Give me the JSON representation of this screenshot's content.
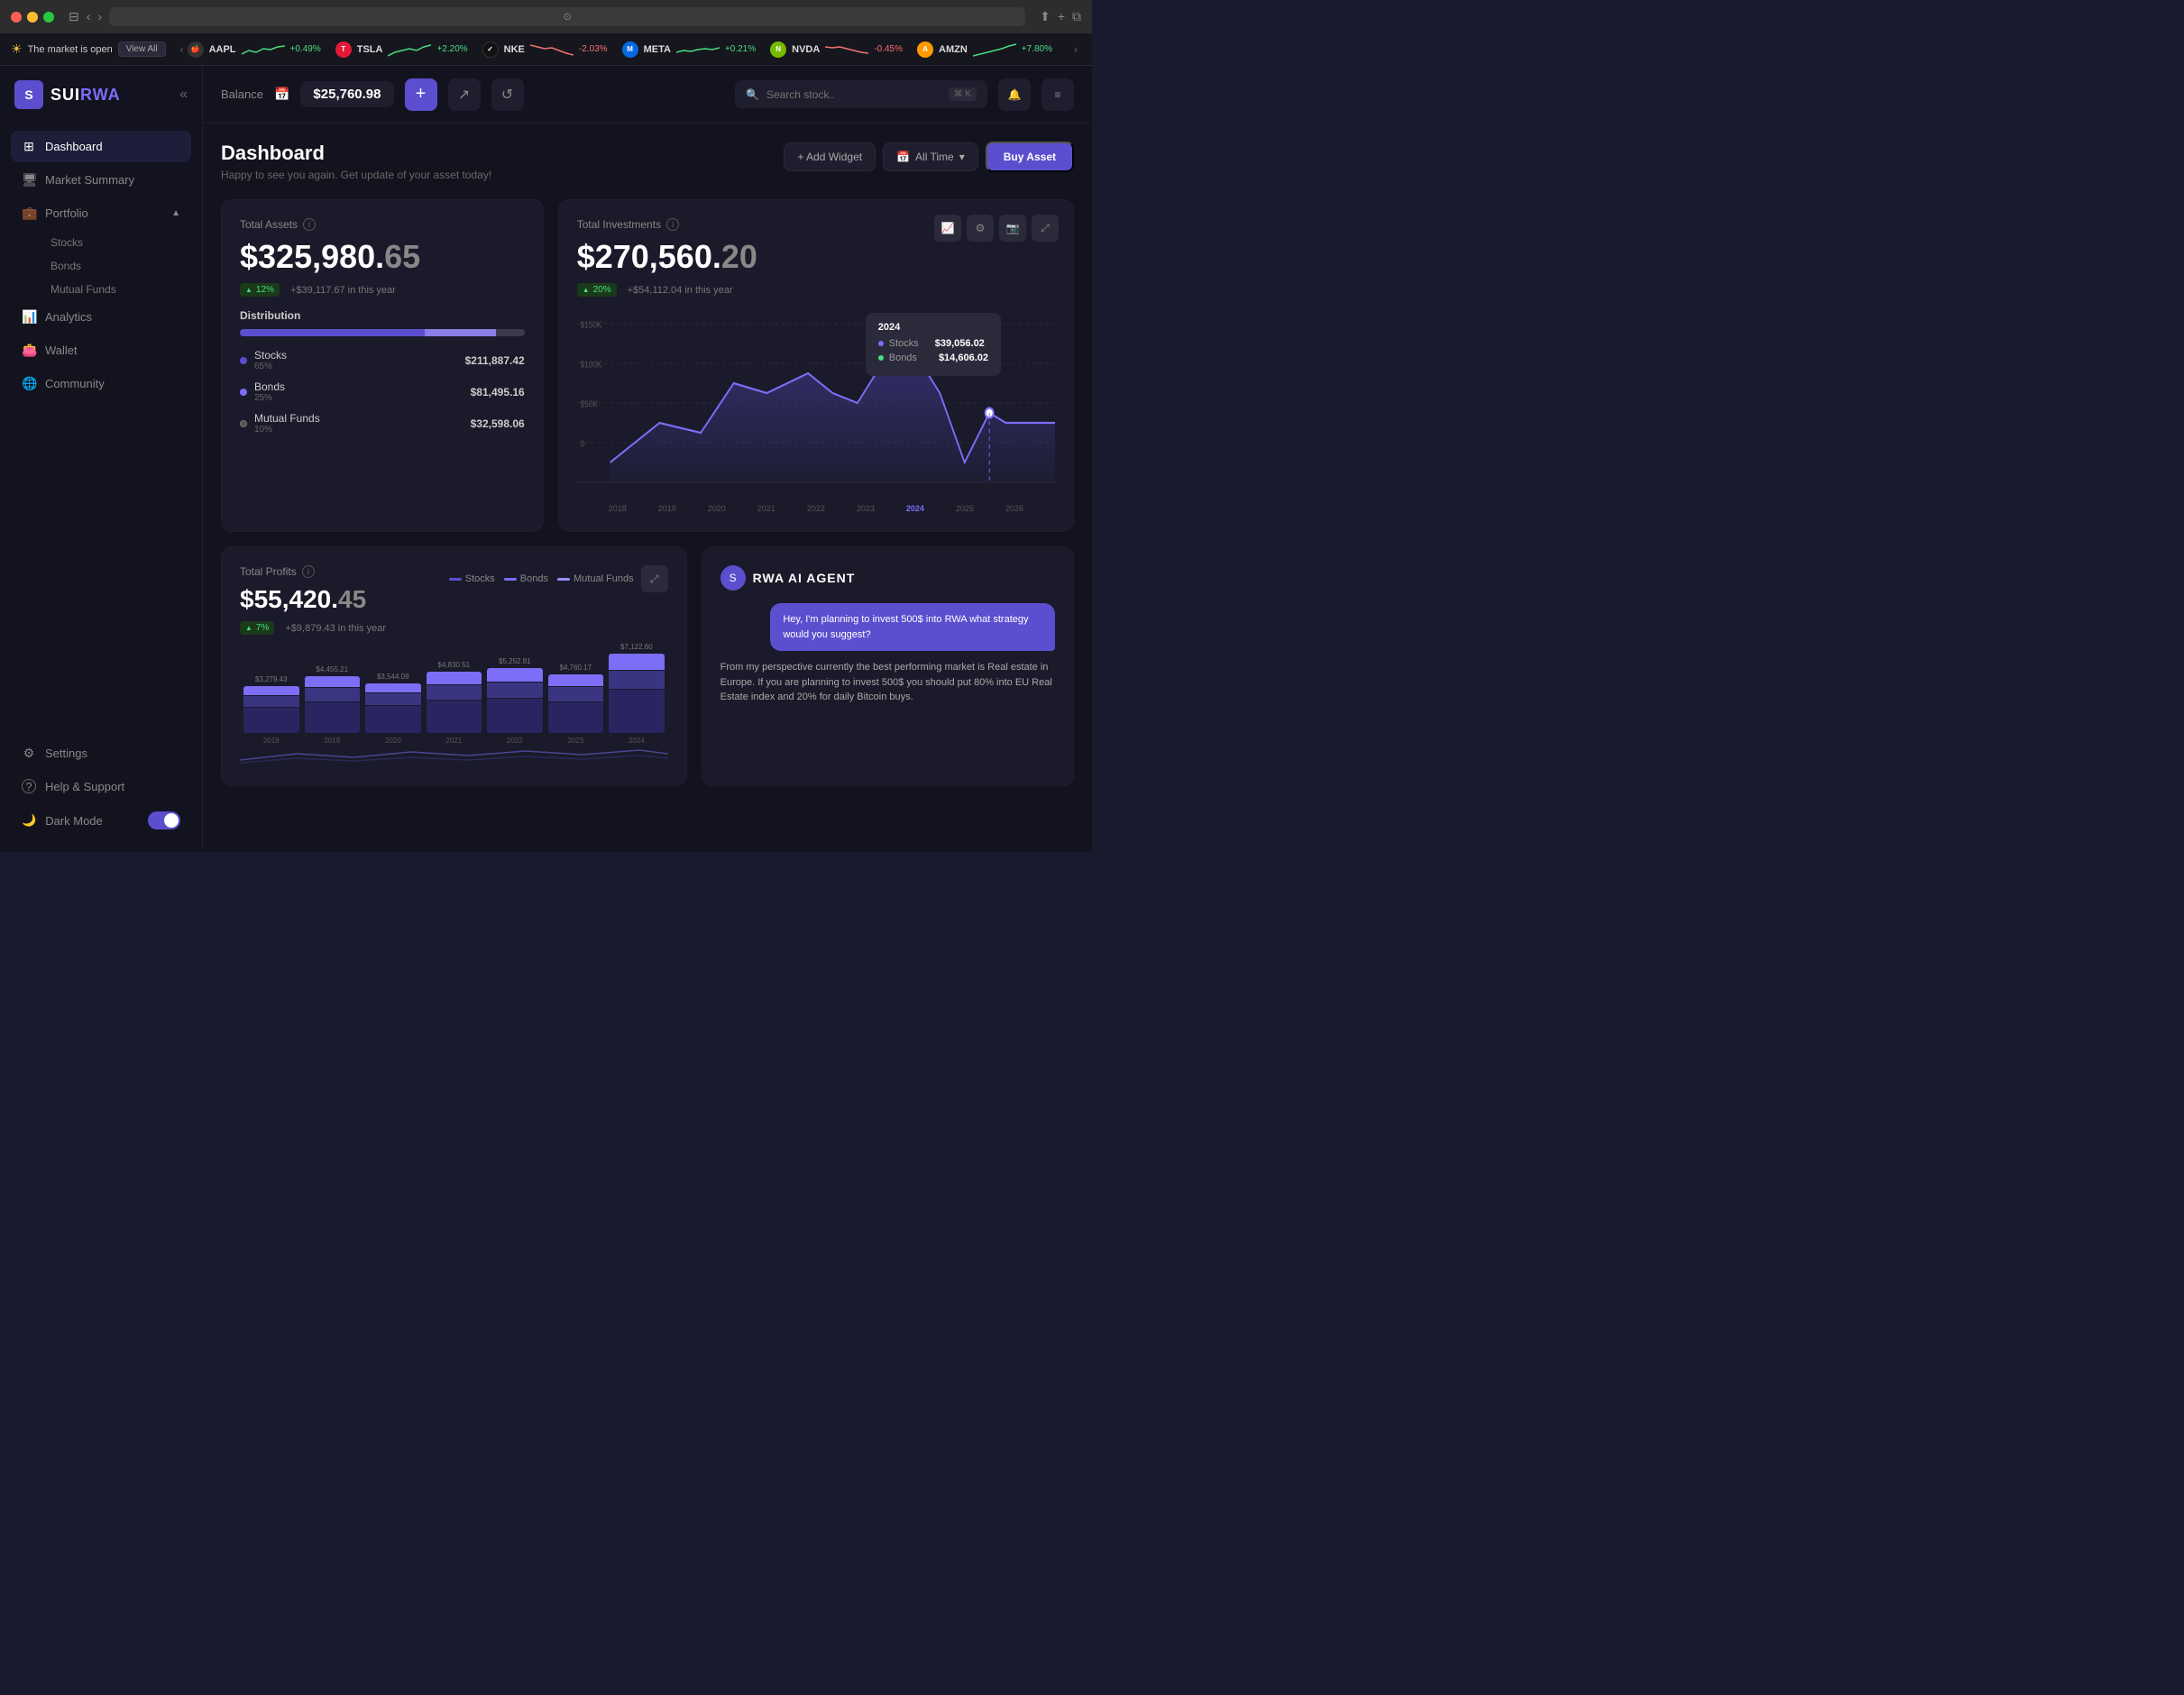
{
  "browser": {
    "address": ""
  },
  "ticker": {
    "market_status": "The market is open",
    "view_all": "View All",
    "items": [
      {
        "symbol": "AAPL",
        "logo_text": "🍎",
        "logo_bg": "#333",
        "change": "+0.49%",
        "positive": true
      },
      {
        "symbol": "TSLA",
        "logo_text": "T",
        "logo_bg": "#e31937",
        "change": "+2.20%",
        "positive": true
      },
      {
        "symbol": "NKE",
        "logo_text": "✓",
        "logo_bg": "#111",
        "change": "-2.03%",
        "positive": false
      },
      {
        "symbol": "META",
        "logo_text": "M",
        "logo_bg": "#0668E1",
        "change": "+0.21%",
        "positive": true
      },
      {
        "symbol": "NVDA",
        "logo_text": "N",
        "logo_bg": "#76b900",
        "change": "-0.45%",
        "positive": false
      },
      {
        "symbol": "AMZN",
        "logo_text": "A",
        "logo_bg": "#FF9900",
        "change": "+7.80%",
        "positive": true
      }
    ]
  },
  "topbar": {
    "balance_label": "Balance",
    "balance_value": "$25,760.98",
    "search_placeholder": "Search stock..",
    "search_kbd": "⌘ K"
  },
  "sidebar": {
    "logo_s": "S",
    "logo_name_sui": "SUI",
    "logo_name_rwa": "RWA",
    "items": [
      {
        "id": "dashboard",
        "label": "Dashboard",
        "icon": "⊞",
        "active": true
      },
      {
        "id": "market-summary",
        "label": "Market Summary",
        "icon": "🖥"
      },
      {
        "id": "portfolio",
        "label": "Portfolio",
        "icon": "💼",
        "has_sub": true
      },
      {
        "id": "stocks",
        "label": "Stocks",
        "sub": true
      },
      {
        "id": "bonds",
        "label": "Bonds",
        "sub": true
      },
      {
        "id": "mutual-funds",
        "label": "Mutual Funds",
        "sub": true
      },
      {
        "id": "analytics",
        "label": "Analytics",
        "icon": "📊"
      },
      {
        "id": "wallet",
        "label": "Wallet",
        "icon": "👛"
      },
      {
        "id": "community",
        "label": "Community",
        "icon": "🌐"
      },
      {
        "id": "settings",
        "label": "Settings",
        "icon": "⚙"
      },
      {
        "id": "help",
        "label": "Help & Support",
        "icon": "?"
      }
    ],
    "dark_mode_label": "Dark Mode"
  },
  "dashboard": {
    "title": "Dashboard",
    "subtitle": "Happy to see you again. Get update of your asset today!",
    "add_widget": "+ Add Widget",
    "all_time": "All Time",
    "buy_asset": "Buy Asset"
  },
  "total_assets": {
    "label": "Total Assets",
    "value_main": "$325,980.",
    "value_decimal": "65",
    "badge_pct": "12%",
    "badge_amount": "+$39,117.67 in this year",
    "dist_label": "Distribution",
    "stocks_label": "Stocks",
    "stocks_pct": "65%",
    "stocks_value": "$211,887.42",
    "bonds_label": "Bonds",
    "bonds_pct": "25%",
    "bonds_value": "$81,495.16",
    "mutual_label": "Mutual Funds",
    "mutual_pct": "10%",
    "mutual_value": "$32,598.06"
  },
  "investments": {
    "label": "Total Investments",
    "value_main": "$270,560.",
    "value_decimal": "20",
    "badge_pct": "20%",
    "badge_amount": "+$54,112.04 in this year",
    "tooltip_year": "2024",
    "tooltip_stocks_label": "Stocks",
    "tooltip_stocks_value": "$39,056.02",
    "tooltip_bonds_label": "Bonds",
    "tooltip_bonds_value": "$14,606.02",
    "y_labels": [
      "$150K",
      "$100K",
      "$50K",
      "0"
    ],
    "x_labels": [
      "2018",
      "2019",
      "2020",
      "2021",
      "2022",
      "2023",
      "2024",
      "2025",
      "2026"
    ]
  },
  "profits": {
    "label": "Total Profits",
    "value_main": "$55,420.",
    "value_decimal": "45",
    "badge_pct": "7%",
    "badge_amount": "+$9,879.43 in this year",
    "legend_stocks": "Stocks",
    "legend_bonds": "Bonds",
    "legend_mutual": "Mutual Funds",
    "bars": [
      {
        "year": "2018",
        "value": "$3,279.43",
        "heights": [
          30,
          15,
          10
        ]
      },
      {
        "year": "2019",
        "value": "$4,455.21",
        "heights": [
          38,
          18,
          12
        ]
      },
      {
        "year": "2020",
        "value": "$3,544.09",
        "heights": [
          32,
          16,
          10
        ]
      },
      {
        "year": "2021",
        "value": "$4,830.51",
        "heights": [
          40,
          20,
          14
        ]
      },
      {
        "year": "2022",
        "value": "$5,252.81",
        "heights": [
          44,
          22,
          15
        ]
      },
      {
        "year": "2023",
        "value": "$4,760.17",
        "heights": [
          40,
          19,
          13
        ]
      },
      {
        "year": "2024",
        "value": "$7,122.60",
        "heights": [
          55,
          26,
          18
        ]
      }
    ]
  },
  "ai_agent": {
    "title": "RWA AI AGENT",
    "user_message": "Hey, I'm planning to invest 500$ into RWA what strategy would you suggest?",
    "bot_message": "From my perspective currently the best performing market is Real estate in Europe. If you are planning to invest 500$ you should put 80% into EU Real Estate index and 20% for daily Bitcoin buys."
  }
}
